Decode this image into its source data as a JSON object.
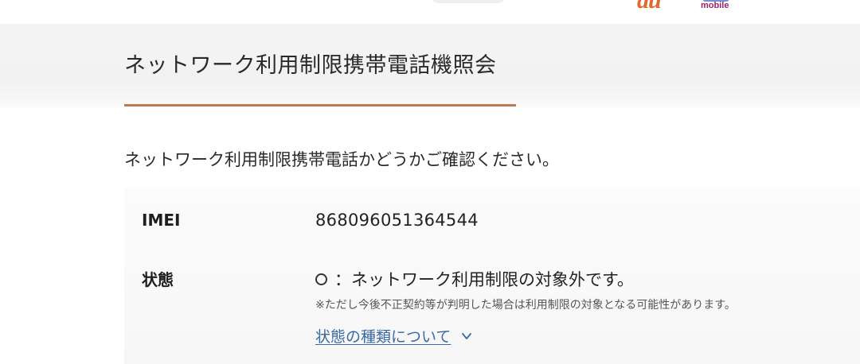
{
  "header": {
    "brand_au": "au",
    "brand_uq": "mobile",
    "title": "ネットワーク利用制限携帯電話機照会"
  },
  "intro_text": "ネットワーク利用制限携帯電話かどうかご確認ください。",
  "result_table": {
    "imei": {
      "label": "IMEI",
      "value": "868096051364544"
    },
    "status": {
      "label": "状態",
      "symbol": "○",
      "value": "：ネットワーク利用制限の対象外です。",
      "note": "※ただし今後不正契約等が判明した場合は利用制限の対象となる可能性があります。",
      "link_text": "状態の種類について",
      "link_icon": "chevron-down-icon"
    }
  },
  "colors": {
    "accent_underline": "#c07a52",
    "link": "#3a6aa0",
    "au_brand": "#e06a2c",
    "uq_brand": "#a0226e"
  }
}
